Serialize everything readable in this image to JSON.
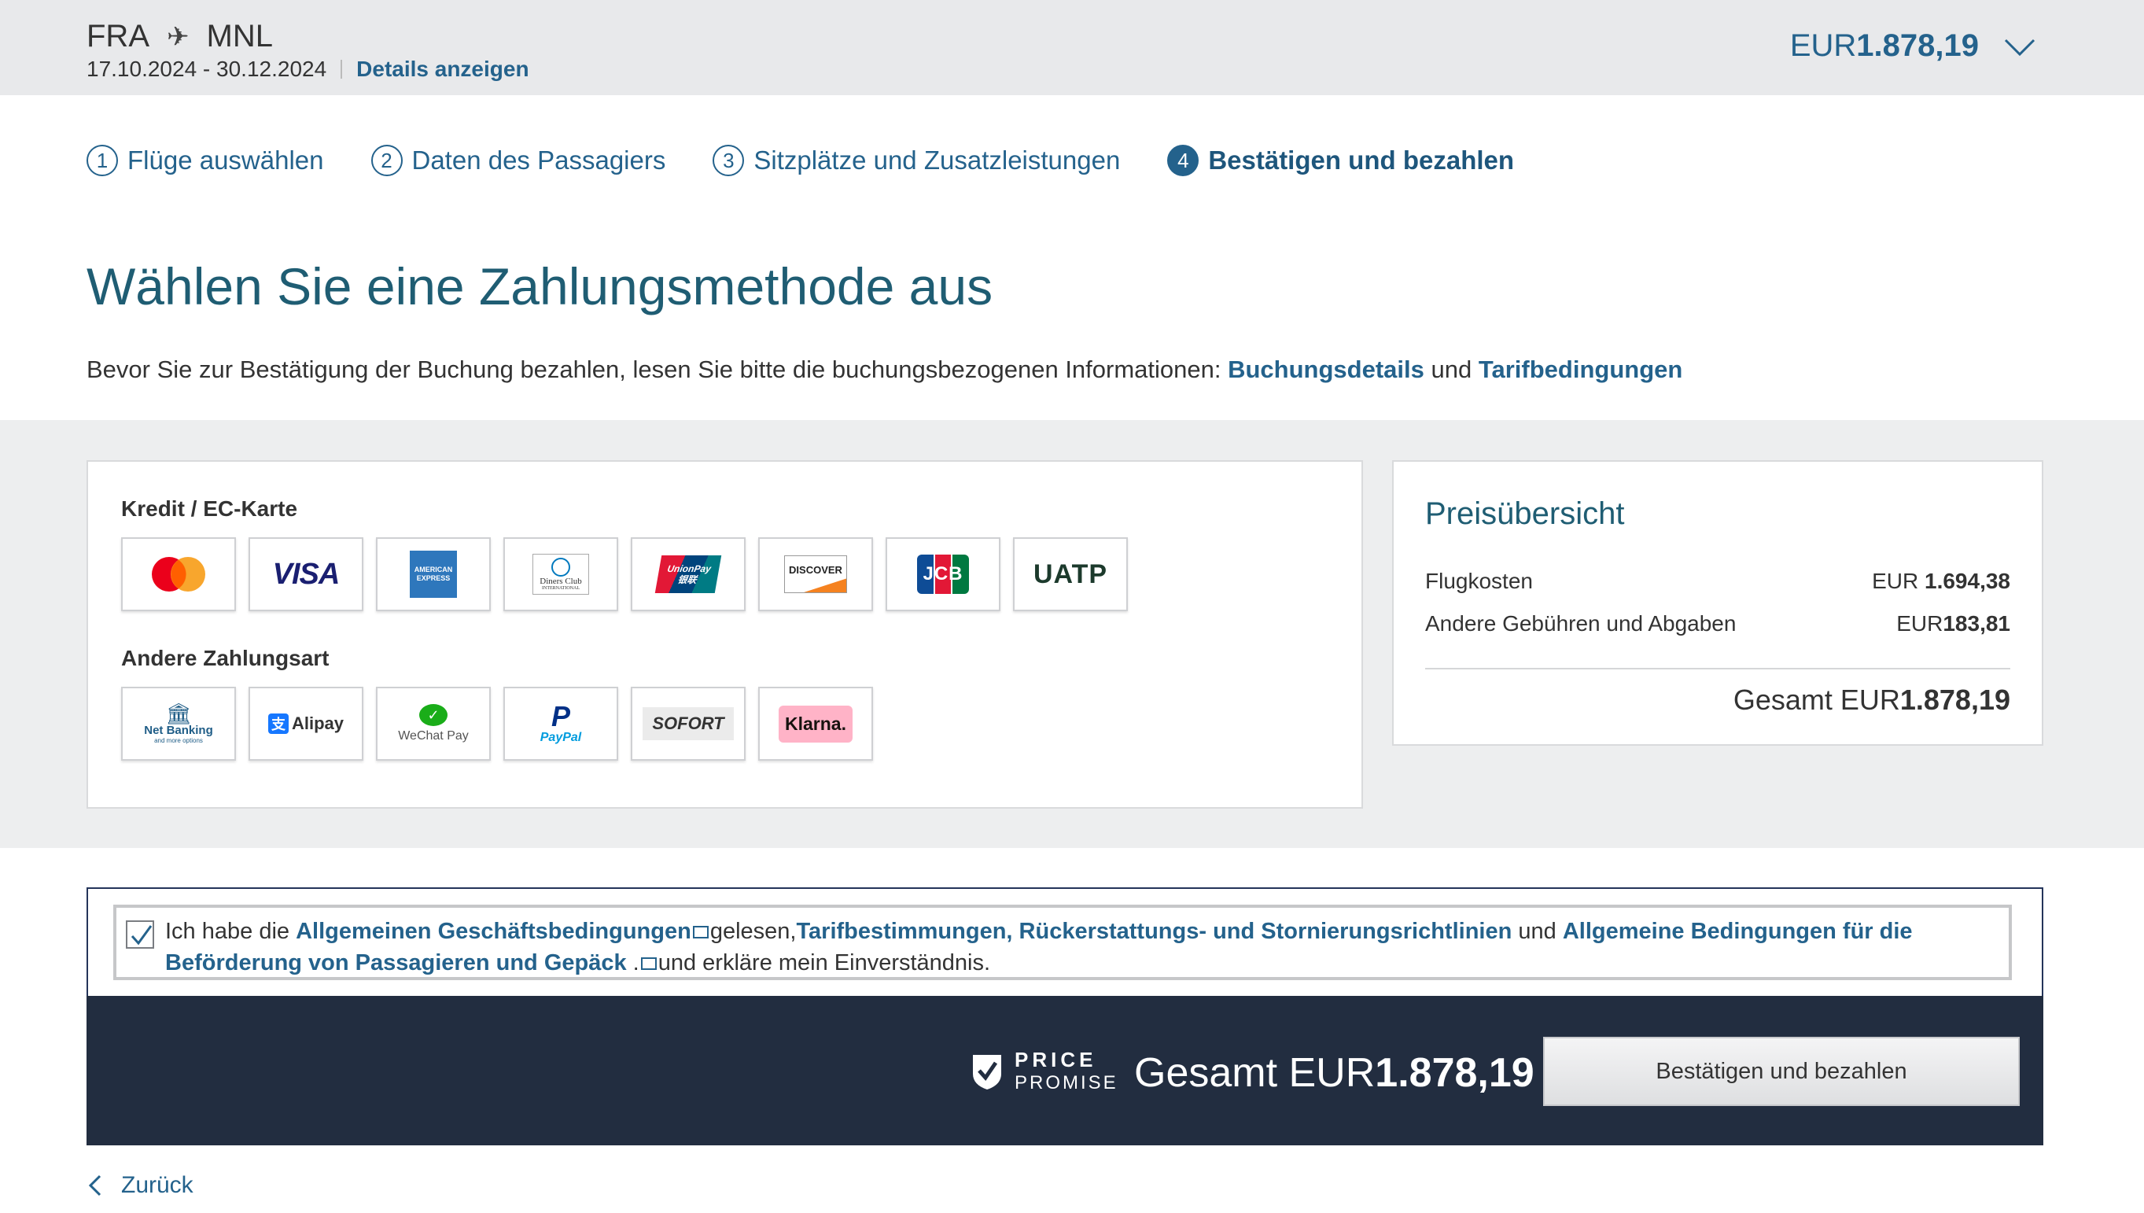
{
  "header": {
    "origin": "FRA",
    "destination": "MNL",
    "dates": "17.10.2024 - 30.12.2024",
    "details_link": "Details anzeigen",
    "price_currency": "EUR",
    "price_amount": "1.878,19"
  },
  "steps": [
    {
      "num": "1",
      "label": "Flüge auswählen"
    },
    {
      "num": "2",
      "label": "Daten des Passagiers"
    },
    {
      "num": "3",
      "label": "Sitzplätze und Zusatzleistungen"
    },
    {
      "num": "4",
      "label": "Bestätigen und bezahlen"
    }
  ],
  "main": {
    "title": "Wählen Sie eine Zahlungsmethode aus",
    "intro_text": "Bevor Sie zur Bestätigung der Buchung bezahlen, lesen Sie bitte die buchungsbezogenen Informationen:",
    "intro_link1": "Buchungsdetails",
    "intro_and": "und",
    "intro_link2": "Tarifbedingungen"
  },
  "payment": {
    "cards_label": "Kredit / EC-Karte",
    "other_label": "Andere Zahlungsart",
    "cards": [
      "Mastercard",
      "VISA",
      "American Express",
      "Diners Club International",
      "UnionPay",
      "DISCOVER",
      "JCB",
      "UATP"
    ],
    "other": [
      "Net Banking",
      "Alipay",
      "WeChat Pay",
      "PayPal",
      "SOFORT",
      "Klarna."
    ],
    "logo_text": {
      "visa": "VISA",
      "amex_top": "AMERICAN",
      "amex_bottom": "EXPRESS",
      "diners_1": "Diners Club",
      "diners_2": "INTERNATIONAL",
      "unionpay": "UnionPay",
      "unionpay_cn": "银联",
      "discover": "DISCOVER",
      "jcb": "JCB",
      "uatp": "UATP",
      "netbanking_1": "Net Banking",
      "netbanking_2": "and more options",
      "alipay": "Alipay",
      "wechat": "WeChat Pay",
      "paypal": "PayPal",
      "sofort": "SOFORT",
      "klarna": "Klarna."
    }
  },
  "summary": {
    "title": "Preisübersicht",
    "rows": [
      {
        "label": "Flugkosten",
        "currency": "EUR",
        "amount": "1.694,38"
      },
      {
        "label": "Andere Gebühren und Abgaben",
        "currency": "EUR",
        "amount": "183,81"
      }
    ],
    "total_label": "Gesamt EUR",
    "total_amount": "1.878,19"
  },
  "terms": {
    "checked": true,
    "t1": "Ich habe die",
    "l1": "Allgemeinen Geschäftsbedingungen",
    "t2": "gelesen,",
    "l2": "Tarifbestimmungen, Rückerstattungs- und Stornierungsrichtlinien",
    "t3": "und",
    "l3": "Allgemeine Bedingungen für die Beförderung von Passagieren und Gepäck",
    "t4": " .",
    "t5": "und erkläre mein Einverständnis."
  },
  "footer": {
    "promise_line1": "PRICE",
    "promise_line2": "PROMISE",
    "total_label": "Gesamt EUR",
    "total_amount": "1.878,19",
    "confirm_button": "Bestätigen und bezahlen"
  },
  "back_link": "Zurück",
  "colors": {
    "accent": "#24628c",
    "title": "#1f5d73",
    "footer_bg": "#222d40",
    "top_bg": "#e8e9eb"
  }
}
